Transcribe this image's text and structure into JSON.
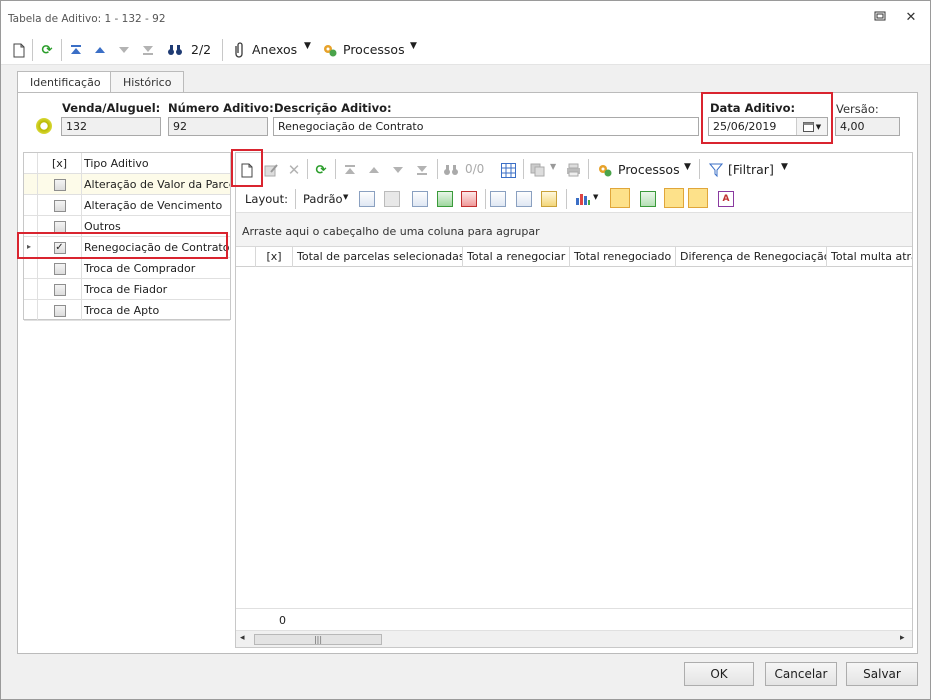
{
  "window": {
    "title": "Tabela de Aditivo: 1 - 132 - 92"
  },
  "toolbar": {
    "pager": "2/2",
    "anexos_label": "Anexos",
    "processos_label": "Processos"
  },
  "tabs": [
    {
      "label": "Identificação",
      "active": true
    },
    {
      "label": "Histórico",
      "active": false
    }
  ],
  "form": {
    "venda_label": "Venda/Aluguel:",
    "venda_value": "132",
    "numero_label": "Número Aditivo:",
    "numero_value": "92",
    "descricao_label": "Descrição Aditivo:",
    "descricao_value": "Renegociação de Contrato",
    "data_label": "Data Aditivo:",
    "data_value": "25/06/2019",
    "versao_label": "Versão:",
    "versao_value": "4,00"
  },
  "tipo_grid": {
    "headers": {
      "check": "[x]",
      "tipo": "Tipo Aditivo"
    },
    "rows": [
      {
        "label": "Alteração de Valor da Parcela",
        "checked": false,
        "current": false
      },
      {
        "label": "Alteração de Vencimento",
        "checked": false,
        "current": false
      },
      {
        "label": "Outros",
        "checked": false,
        "current": false
      },
      {
        "label": "Renegociação de Contrato",
        "checked": true,
        "current": true
      },
      {
        "label": "Troca de Comprador",
        "checked": false,
        "current": false
      },
      {
        "label": "Troca de Fiador",
        "checked": false,
        "current": false
      },
      {
        "label": "Troca de Apto",
        "checked": false,
        "current": false
      }
    ]
  },
  "detail_toolbar": {
    "counter": "0/0",
    "processos_label": "Processos",
    "filtrar_label": "[Filtrar]",
    "layout_label": "Layout:",
    "padrao_label": "Padrão"
  },
  "detail_grid": {
    "group_hint": "Arraste aqui o cabeçalho de uma coluna para agrupar",
    "columns": [
      "[x]",
      "Total de parcelas selecionadas",
      "Total a renegociar",
      "Total renegociado",
      "Diferença de Renegociação",
      "Total multa atraso"
    ],
    "footer_count": "0"
  },
  "buttons": {
    "ok": "OK",
    "cancelar": "Cancelar",
    "salvar": "Salvar"
  },
  "colors": {
    "highlight_red": "#d9242f",
    "green_icon": "#2a9d2a",
    "blue_icon": "#3b6fc6"
  }
}
